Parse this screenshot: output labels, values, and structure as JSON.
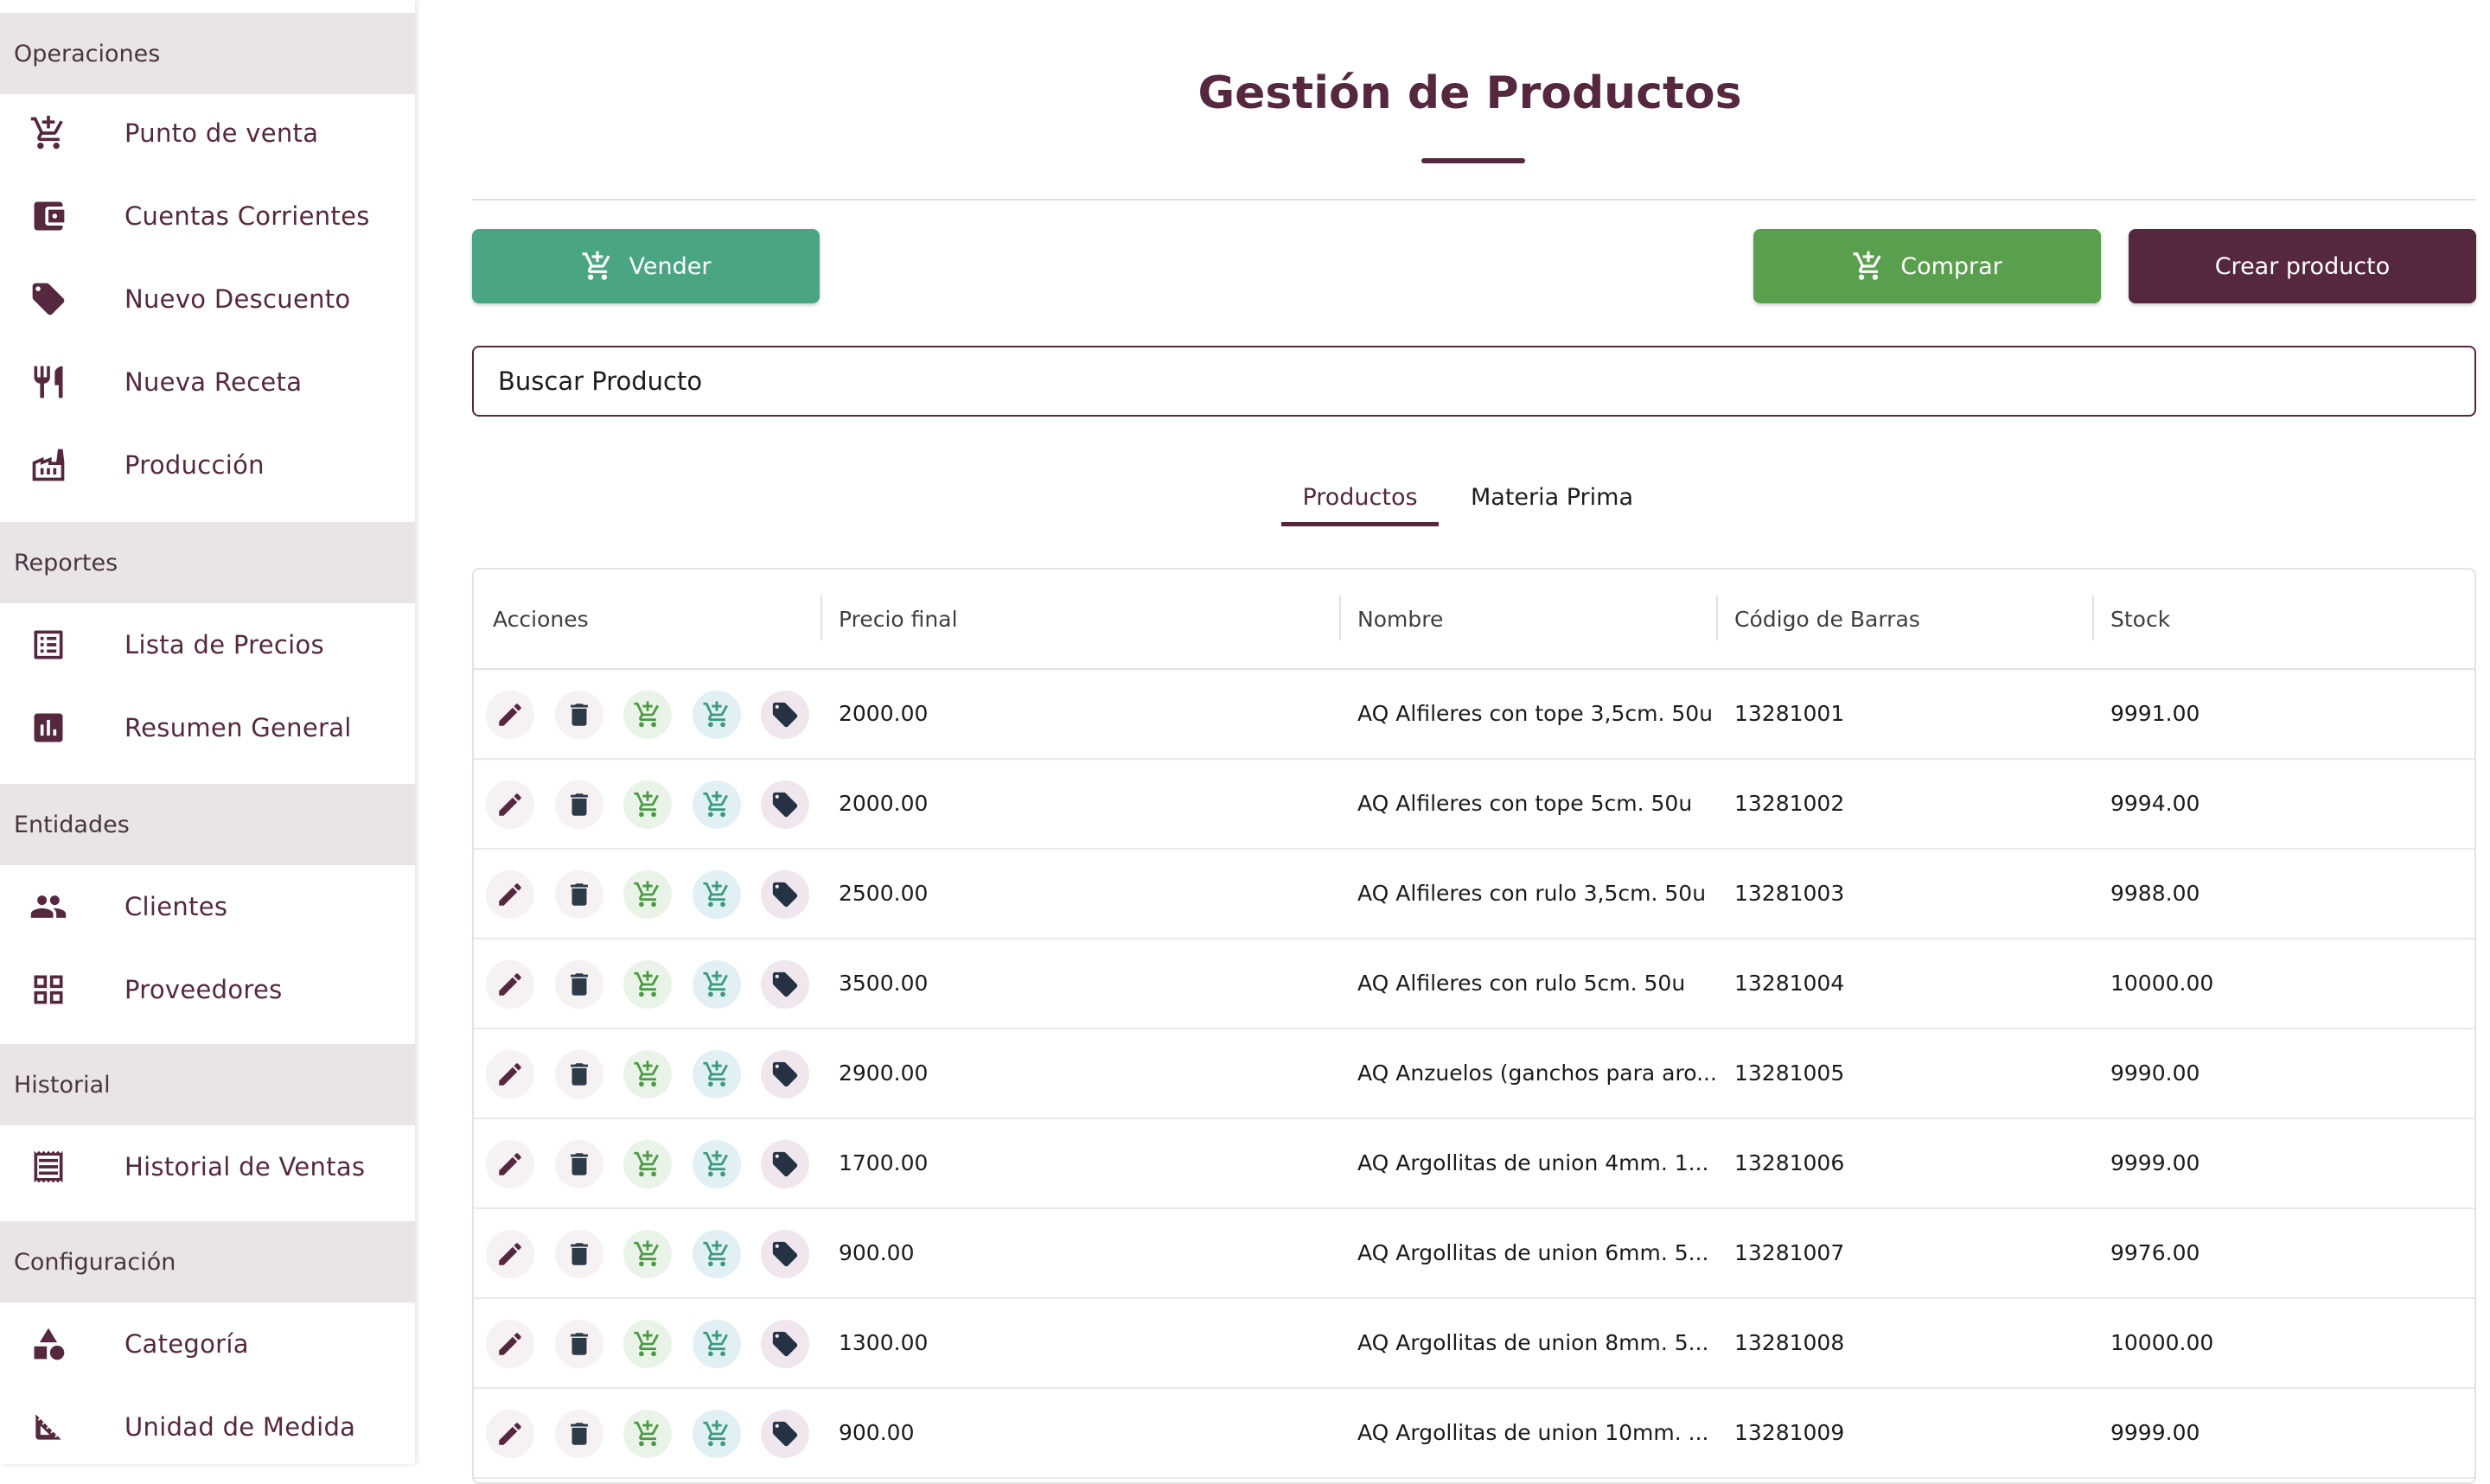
{
  "sidebar": {
    "sections": [
      {
        "title": "Operaciones",
        "items": [
          {
            "label": "Punto de venta",
            "icon": "cart-plus-icon"
          },
          {
            "label": "Cuentas Corrientes",
            "icon": "wallet-icon"
          },
          {
            "label": "Nuevo Descuento",
            "icon": "tag-icon"
          },
          {
            "label": "Nueva Receta",
            "icon": "restaurant-icon"
          },
          {
            "label": "Producción",
            "icon": "factory-icon"
          }
        ]
      },
      {
        "title": "Reportes",
        "items": [
          {
            "label": "Lista de Precios",
            "icon": "list-icon"
          },
          {
            "label": "Resumen General",
            "icon": "bar-chart-icon"
          }
        ]
      },
      {
        "title": "Entidades",
        "items": [
          {
            "label": "Clientes",
            "icon": "people-icon"
          },
          {
            "label": "Proveedores",
            "icon": "grid-icon"
          }
        ]
      },
      {
        "title": "Historial",
        "items": [
          {
            "label": "Historial de Ventas",
            "icon": "receipt-icon"
          }
        ]
      },
      {
        "title": "Configuración",
        "items": [
          {
            "label": "Categoría",
            "icon": "category-icon"
          },
          {
            "label": "Unidad de Medida",
            "icon": "ruler-icon"
          }
        ]
      }
    ]
  },
  "page": {
    "title": "Gestión de Productos"
  },
  "buttons": {
    "vender": "Vender",
    "comprar": "Comprar",
    "crear": "Crear producto"
  },
  "search": {
    "placeholder": "Buscar Producto"
  },
  "tabs": [
    {
      "label": "Productos",
      "active": true
    },
    {
      "label": "Materia Prima",
      "active": false
    }
  ],
  "table": {
    "columns": [
      "Acciones",
      "Precio final",
      "Nombre",
      "Código de Barras",
      "Stock"
    ],
    "rows": [
      {
        "precio": "2000.00",
        "nombre": "AQ Alfileres con tope 3,5cm. 50u",
        "codigo": "13281001",
        "stock": "9991.00"
      },
      {
        "precio": "2000.00",
        "nombre": "AQ Alfileres con tope 5cm. 50u",
        "codigo": "13281002",
        "stock": "9994.00"
      },
      {
        "precio": "2500.00",
        "nombre": "AQ Alfileres con rulo 3,5cm. 50u",
        "codigo": "13281003",
        "stock": "9988.00"
      },
      {
        "precio": "3500.00",
        "nombre": "AQ Alfileres con rulo 5cm. 50u",
        "codigo": "13281004",
        "stock": "10000.00"
      },
      {
        "precio": "2900.00",
        "nombre": "AQ Anzuelos (ganchos para aro...",
        "codigo": "13281005",
        "stock": "9990.00"
      },
      {
        "precio": "1700.00",
        "nombre": "AQ Argollitas de union 4mm. 1...",
        "codigo": "13281006",
        "stock": "9999.00"
      },
      {
        "precio": "900.00",
        "nombre": "AQ Argollitas de union 6mm. 5...",
        "codigo": "13281007",
        "stock": "9976.00"
      },
      {
        "precio": "1300.00",
        "nombre": "AQ Argollitas de union 8mm. 5...",
        "codigo": "13281008",
        "stock": "10000.00"
      },
      {
        "precio": "900.00",
        "nombre": "AQ Argollitas de union 10mm. ...",
        "codigo": "13281009",
        "stock": "9999.00"
      }
    ]
  },
  "colors": {
    "primary": "#55283f",
    "vender": "#4aa583",
    "comprar": "#5a9f4d"
  }
}
